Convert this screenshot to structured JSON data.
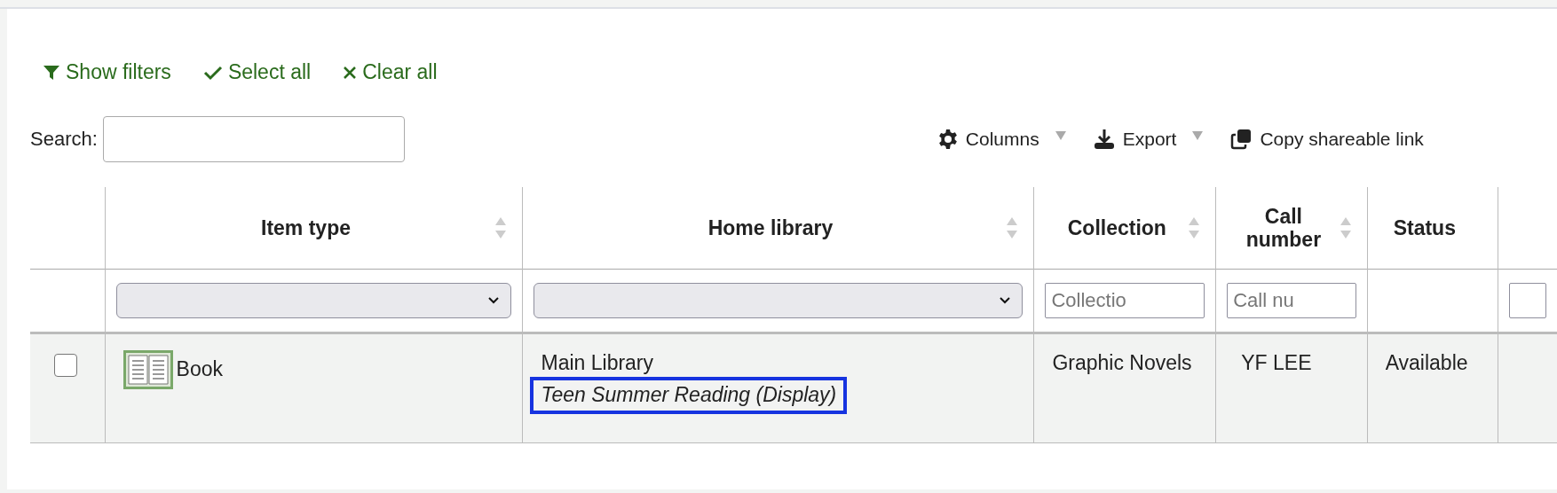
{
  "toolbar": [
    {
      "kind": "filter",
      "label": "Show filters"
    },
    {
      "kind": "check",
      "label": "Select all"
    },
    {
      "kind": "cross",
      "label": "Clear all"
    }
  ],
  "search": {
    "label": "Search:"
  },
  "buttons": [
    {
      "kind": "gear",
      "label": "Columns",
      "dropdown": true
    },
    {
      "kind": "download",
      "label": "Export",
      "dropdown": true
    },
    {
      "kind": "copy",
      "label": "Copy shareable link",
      "dropdown": false
    }
  ],
  "table": {
    "columns": [
      {
        "label": "Item type",
        "sortable": true
      },
      {
        "label": "Home library",
        "sortable": true
      },
      {
        "label": "Collection",
        "sortable": true
      },
      {
        "label": "Call number",
        "sortable": true
      },
      {
        "label": "Status",
        "sortable": false
      }
    ],
    "filters": [
      {
        "kind": "select"
      },
      {
        "kind": "select"
      },
      {
        "kind": "text",
        "placeholder": "Collectio"
      },
      {
        "kind": "text",
        "placeholder": "Call nu"
      },
      {
        "kind": "none"
      }
    ],
    "rows": [
      {
        "checked": false,
        "item_type": "Book",
        "home_library": "Main Library",
        "location": "Teen Summer Reading (Display)",
        "location_outlined": true,
        "collection": "Graphic Novels",
        "call_number": "YF LEE",
        "status": "Available"
      }
    ]
  }
}
